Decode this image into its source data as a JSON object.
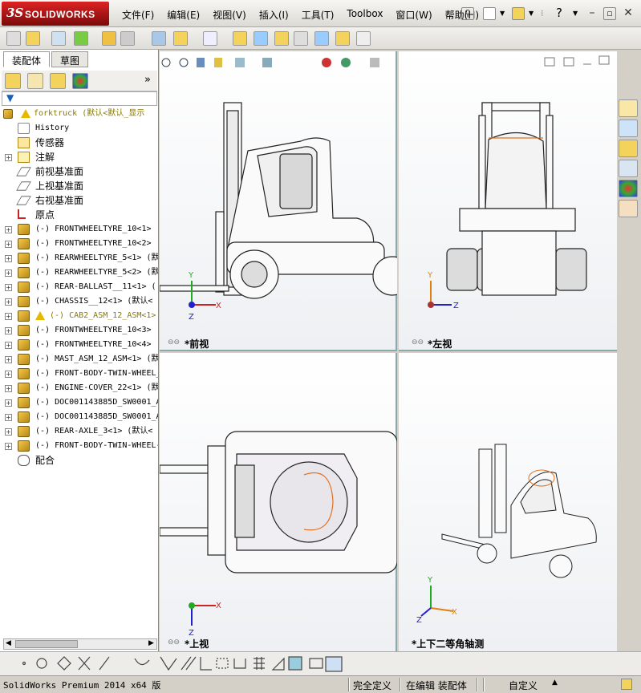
{
  "app": {
    "logo_ds": "3S",
    "logo_text": "SOLIDWORKS"
  },
  "menu": [
    "文件(F)",
    "编辑(E)",
    "视图(V)",
    "插入(I)",
    "工具(T)",
    "Toolbox",
    "窗口(W)",
    "帮助(H)"
  ],
  "panel_tabs": [
    "装配体",
    "草图"
  ],
  "tree": {
    "root": "forktruck  (默认<默认_显示",
    "items": [
      {
        "label": "History",
        "icon": "history-icon",
        "expand": false
      },
      {
        "label": "传感器",
        "icon": "sensor-icon",
        "expand": false,
        "cjk": true
      },
      {
        "label": "注解",
        "icon": "annotation-icon",
        "expand": true,
        "cjk": true
      },
      {
        "label": "前视基准面",
        "icon": "plane-icon",
        "expand": false,
        "cjk": true
      },
      {
        "label": "上视基准面",
        "icon": "plane-icon",
        "expand": false,
        "cjk": true
      },
      {
        "label": "右视基准面",
        "icon": "plane-icon",
        "expand": false,
        "cjk": true
      },
      {
        "label": "原点",
        "icon": "origin-icon",
        "expand": false,
        "cjk": true
      },
      {
        "label": "(-) FRONTWHEELTYRE_10<1>",
        "icon": "part-icon",
        "expand": true
      },
      {
        "label": "(-) FRONTWHEELTYRE_10<2>",
        "icon": "part-icon",
        "expand": true
      },
      {
        "label": "(-) REARWHEELTYRE_5<1> (默",
        "icon": "part-icon",
        "expand": true
      },
      {
        "label": "(-) REARWHEELTYRE_5<2> (默",
        "icon": "part-icon",
        "expand": true
      },
      {
        "label": "(-) REAR-BALLAST__11<1> (",
        "icon": "part-icon",
        "expand": true
      },
      {
        "label": "(-) CHASSIS__12<1> (默认<",
        "icon": "part-icon",
        "expand": true
      },
      {
        "label": "(-) CAB2_ASM_12_ASM<1>",
        "icon": "assembly-warning-icon",
        "expand": true,
        "warn": true
      },
      {
        "label": "(-) FRONTWHEELTYRE_10<3>",
        "icon": "part-icon",
        "expand": true
      },
      {
        "label": "(-) FRONTWHEELTYRE_10<4>",
        "icon": "part-icon",
        "expand": true
      },
      {
        "label": "(-) MAST_ASM_12_ASM<1> (默",
        "icon": "assembly-icon",
        "expand": true
      },
      {
        "label": "(-) FRONT-BODY-TWIN-WHEEL_",
        "icon": "assembly-icon",
        "expand": true
      },
      {
        "label": "(-) ENGINE-COVER_22<1> (默",
        "icon": "part-icon",
        "expand": true
      },
      {
        "label": "(-) DOC001143885D_SW0001_A",
        "icon": "assembly-icon",
        "expand": true
      },
      {
        "label": "(-) DOC001143885D_SW0001_A",
        "icon": "assembly-icon",
        "expand": true
      },
      {
        "label": "(-) REAR-AXLE_3<1> (默认<",
        "icon": "part-icon",
        "expand": true
      },
      {
        "label": "(-) FRONT-BODY-TWIN-WHEEL-",
        "icon": "part-icon",
        "expand": true
      },
      {
        "label": "配合",
        "icon": "mates-icon",
        "expand": false,
        "cjk": true
      }
    ]
  },
  "viewports": {
    "front": "*前视",
    "left": "*左视",
    "top": "*上视",
    "iso": "*上下二等角轴测"
  },
  "axes": {
    "x": "X",
    "y": "Y",
    "z": "Z"
  },
  "status": {
    "product": "SolidWorks Premium 2014 x64 版",
    "defined": "完全定义",
    "editing": "在编辑 装配体",
    "units": "自定义"
  }
}
